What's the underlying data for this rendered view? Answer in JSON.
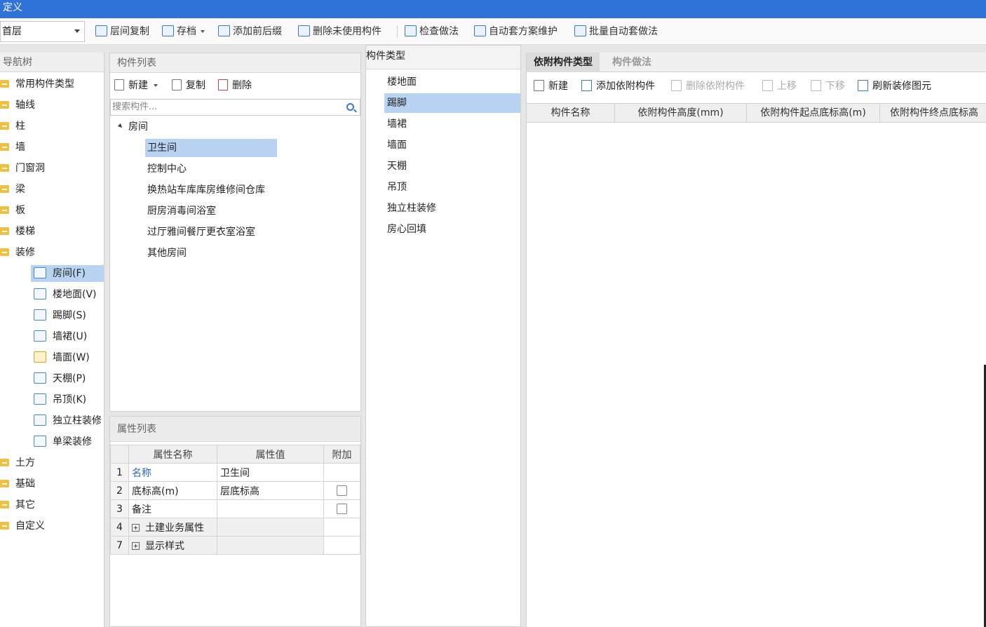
{
  "window": {
    "title": "定义"
  },
  "toolbar": {
    "floor": "首层",
    "buttons": [
      {
        "label": "层间复制",
        "icon": "copy-floor-icon"
      },
      {
        "label": "存档",
        "icon": "archive-icon"
      },
      {
        "label": "添加前后缀",
        "icon": "add-affix-icon"
      },
      {
        "label": "删除未使用构件",
        "icon": "delete-unused-icon"
      },
      {
        "label": "检查做法",
        "icon": "check-method-icon"
      },
      {
        "label": "自动套方案维护",
        "icon": "auto-scheme-icon"
      },
      {
        "label": "批量自动套做法",
        "icon": "batch-auto-icon"
      }
    ]
  },
  "nav": {
    "title": "导航树",
    "items": [
      {
        "label": "常用构件类型"
      },
      {
        "label": "轴线"
      },
      {
        "label": "柱"
      },
      {
        "label": "墙"
      },
      {
        "label": "门窗洞"
      },
      {
        "label": "梁"
      },
      {
        "label": "板"
      },
      {
        "label": "楼梯"
      },
      {
        "label": "装修"
      }
    ],
    "sub_items": [
      {
        "label": "房间(F)",
        "icon": "room-icon"
      },
      {
        "label": "楼地面(V)",
        "icon": "floor-surface-icon"
      },
      {
        "label": "踢脚(S)",
        "icon": "skirting-icon"
      },
      {
        "label": "墙裙(U)",
        "icon": "wainscot-icon"
      },
      {
        "label": "墙面(W)",
        "icon": "wall-surface-icon"
      },
      {
        "label": "天棚(P)",
        "icon": "ceiling-icon"
      },
      {
        "label": "吊顶(K)",
        "icon": "suspended-ceiling-icon"
      },
      {
        "label": "独立柱装修",
        "icon": "column-finish-icon"
      },
      {
        "label": "单梁装修",
        "icon": "beam-finish-icon"
      }
    ],
    "after_items": [
      {
        "label": "土方"
      },
      {
        "label": "基础"
      },
      {
        "label": "其它"
      },
      {
        "label": "自定义"
      }
    ]
  },
  "component_list": {
    "title": "构件列表",
    "new_label": "新建",
    "copy_label": "复制",
    "delete_label": "删除",
    "search_placeholder": "搜索构件...",
    "root": "房间",
    "children": [
      "卫生间",
      "控制中心",
      "换热站车库库房维修间仓库",
      "厨房消毒间浴室",
      "过厅雅间餐厅更衣室浴室",
      "其他房间"
    ]
  },
  "property_list": {
    "title": "属性列表",
    "headers": [
      "属性名称",
      "属性值",
      "附加"
    ],
    "rows": [
      {
        "num": "1",
        "name": "名称",
        "value": "卫生间"
      },
      {
        "num": "2",
        "name": "底标高(m)",
        "value": "层底标高"
      },
      {
        "num": "3",
        "name": "备注",
        "value": ""
      },
      {
        "num": "4",
        "name": "土建业务属性",
        "value": ""
      },
      {
        "num": "7",
        "name": "显示样式",
        "value": ""
      }
    ]
  },
  "component_type": {
    "title": "构件类型",
    "items": [
      "楼地面",
      "踢脚",
      "墙裙",
      "墙面",
      "天棚",
      "吊顶",
      "独立柱装修",
      "房心回填"
    ]
  },
  "right_panel": {
    "tabs": [
      "依附构件类型",
      "构件做法"
    ],
    "toolbar": [
      "新建",
      "添加依附构件",
      "删除依附构件",
      "上移",
      "下移",
      "刷新装修图元"
    ],
    "columns": [
      "构件名称",
      "依附构件高度(mm)",
      "依附构件起点底标高(m)",
      "依附构件终点底标高"
    ]
  }
}
